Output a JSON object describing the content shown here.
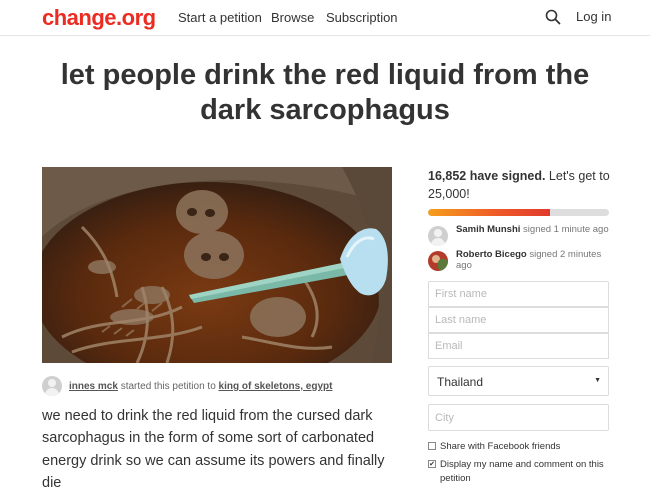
{
  "header": {
    "logo": "change.org",
    "nav": [
      "Start a petition",
      "Browse",
      "Subscription"
    ],
    "login": "Log in"
  },
  "petition": {
    "title": "let people drink the red liquid from the dark sarcophagus",
    "starter_name": "innes mck",
    "started_text": "started this petition to",
    "target": "king of skeletons, egypt",
    "description": "we need to drink the red liquid from the cursed dark sarcophagus in the form of some sort of carbonated energy drink so we can assume its powers and finally die"
  },
  "sidebar": {
    "signed_count": "16,852 have signed.",
    "goal_text": "Let's get to 25,000!",
    "progress_fraction": 0.674,
    "signers": [
      {
        "name": "Samih Munshi",
        "action": "signed 1 minute ago"
      },
      {
        "name": "Roberto Bicego",
        "action": "signed 2 minutes ago"
      }
    ],
    "form": {
      "first_name_placeholder": "First name",
      "last_name_placeholder": "Last name",
      "email_placeholder": "Email",
      "country": "Thailand",
      "city_placeholder": "City",
      "share_facebook": "Share with Facebook friends",
      "display_name": "Display my name and comment on this petition"
    }
  }
}
